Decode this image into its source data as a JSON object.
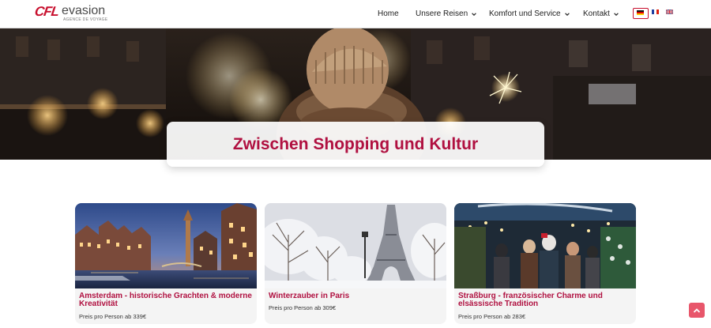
{
  "brand": {
    "mark": "CFL",
    "name": "evasion",
    "tagline": "AGENCE DE VOYAGE"
  },
  "nav": {
    "items": [
      {
        "label": "Home",
        "dropdown": false
      },
      {
        "label": "Unsere Reisen",
        "dropdown": true
      },
      {
        "label": "Komfort und Service",
        "dropdown": true
      },
      {
        "label": "Kontakt",
        "dropdown": true
      }
    ],
    "languages": [
      {
        "code": "de",
        "active": true
      },
      {
        "code": "fr",
        "active": false
      },
      {
        "code": "en",
        "active": false
      }
    ]
  },
  "hero": {
    "title": "Zwischen Shopping und Kultur"
  },
  "cards": [
    {
      "title": "Amsterdam - historische Grachten & moderne Kreativität",
      "price": "Preis pro Person ab 339€"
    },
    {
      "title": "Winterzauber in Paris",
      "price": "Preis pro Person ab 309€"
    },
    {
      "title": "Straßburg - französischer Charme und elsässische Tradition",
      "price": "Preis pro Person ab 283€"
    }
  ],
  "colors": {
    "accent": "#b01040",
    "brand_red": "#c8102e",
    "scroll_button": "#e8566b"
  },
  "icons": {
    "scroll_top": "chevron-up-icon",
    "dropdown": "chevron-down-icon"
  }
}
